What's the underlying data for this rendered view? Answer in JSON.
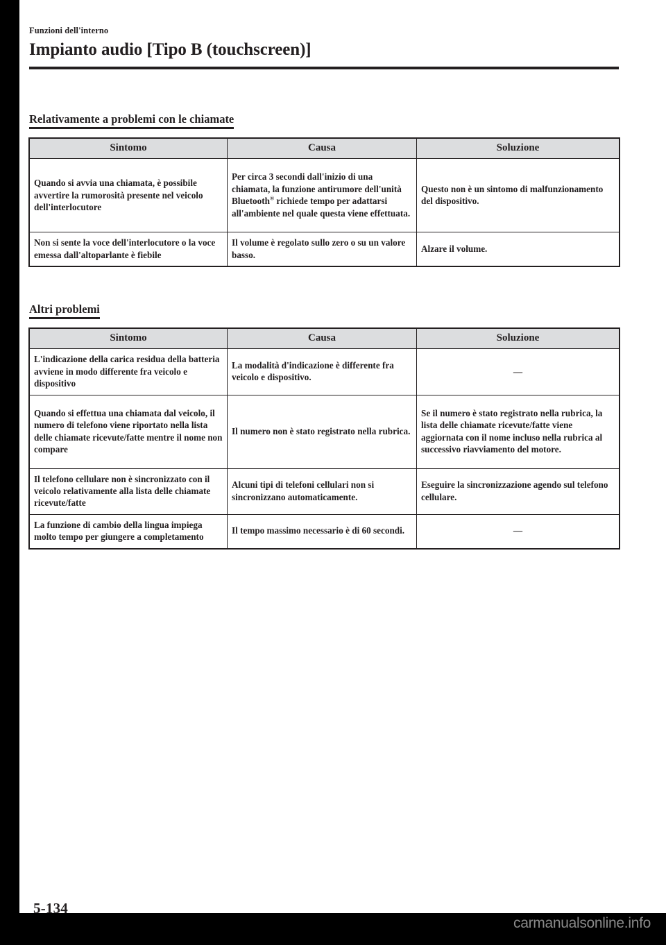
{
  "header": {
    "chapter_label": "Funzioni dell'interno",
    "page_title": "Impianto audio [Tipo B (touchscreen)]"
  },
  "sections": [
    {
      "heading": "Relativamente a problemi con le chiamate",
      "table": {
        "columns": [
          "Sintomo",
          "Causa",
          "Soluzione"
        ],
        "rows": [
          {
            "sintomo": "Quando si avvia una chiamata, è possibile avvertire la rumorosità presente nel veicolo dell'interlocutore",
            "causa_pre": "Per circa 3 secondi dall'inizio di una chiamata, la funzione antirumore dell'unità Bluetooth",
            "causa_sup": "®",
            "causa_post": " richiede tempo per adattarsi all'ambiente nel quale questa viene effettuata.",
            "soluzione": "Questo non è un sintomo di malfunzionamento del dispositivo."
          },
          {
            "sintomo": "Non si sente la voce dell'interlocutore o la voce emessa dall'altoparlante è fiebile",
            "causa": "Il volume è regolato sullo zero o su un valore basso.",
            "soluzione": "Alzare il volume."
          }
        ]
      }
    },
    {
      "heading": "Altri problemi",
      "table": {
        "columns": [
          "Sintomo",
          "Causa",
          "Soluzione"
        ],
        "rows": [
          {
            "sintomo": "L'indicazione della carica residua della batteria avviene in modo differente fra veicolo e dispositivo",
            "causa": "La modalità d'indicazione è differente fra veicolo e dispositivo.",
            "soluzione": "—"
          },
          {
            "sintomo": "Quando si effettua una chiamata dal veicolo, il numero di telefono viene riportato nella lista delle chiamate ricevute/fatte mentre il nome non compare",
            "causa": "Il numero non è stato registrato nella rubrica.",
            "soluzione": "Se il numero è stato registrato nella rubrica, la lista delle chiamate ricevute/fatte viene aggiornata con il nome incluso nella rubrica al successivo riavviamento del motore."
          },
          {
            "sintomo": "Il telefono cellulare non è sincronizzato con il veicolo relativamente alla lista delle chiamate ricevute/fatte",
            "causa": "Alcuni tipi di telefoni cellulari non si sincronizzano automaticamente.",
            "soluzione": "Eseguire la sincronizzazione agendo sul telefono cellulare."
          },
          {
            "sintomo": "La funzione di cambio della lingua impiega molto tempo per giungere a completamento",
            "causa": "Il tempo massimo necessario è di 60 secondi.",
            "soluzione": "—"
          }
        ]
      }
    }
  ],
  "footer": {
    "page_number": "5-134",
    "watermark": "carmanualsonline.info"
  },
  "colors": {
    "ink": "#231f20",
    "table_header_fill": "#dcdddf",
    "page_background": "#ffffff",
    "frame": "#000000",
    "watermark_text": "#8a8a8a"
  }
}
